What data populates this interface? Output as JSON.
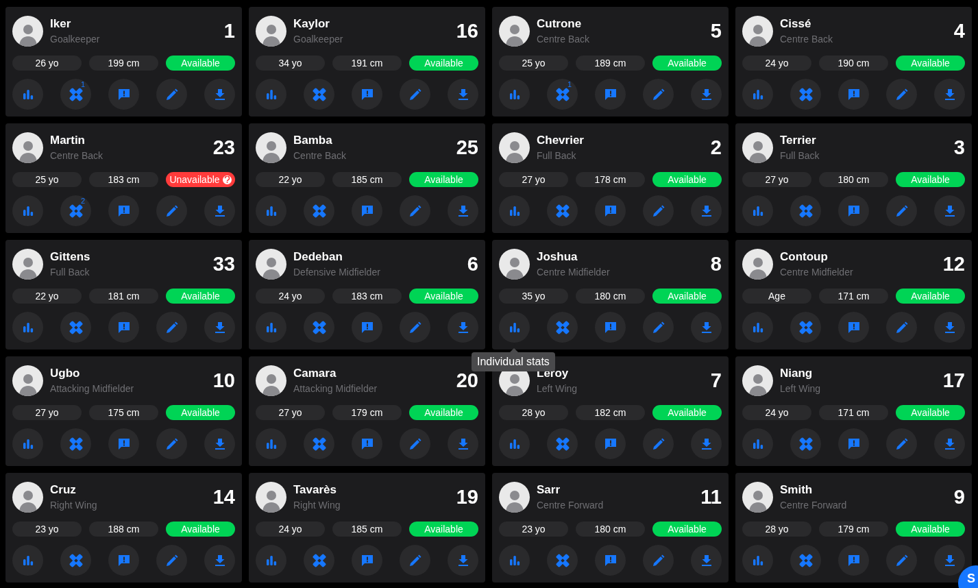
{
  "players": [
    {
      "name": "Iker",
      "position": "Goalkeeper",
      "number": "1",
      "age": "26 yo",
      "height": "199 cm",
      "status": {
        "kind": "available",
        "label": "Available"
      },
      "injuries": "1"
    },
    {
      "name": "Kaylor",
      "position": "Goalkeeper",
      "number": "16",
      "age": "34 yo",
      "height": "191 cm",
      "status": {
        "kind": "available",
        "label": "Available"
      }
    },
    {
      "name": "Cutrone",
      "position": "Centre Back",
      "number": "5",
      "age": "25 yo",
      "height": "189 cm",
      "status": {
        "kind": "available",
        "label": "Available"
      },
      "injuries": "1"
    },
    {
      "name": "Cissé",
      "position": "Centre Back",
      "number": "4",
      "age": "24 yo",
      "height": "190 cm",
      "status": {
        "kind": "available",
        "label": "Available"
      }
    },
    {
      "name": "Martin",
      "position": "Centre Back",
      "number": "23",
      "age": "25 yo",
      "height": "183 cm",
      "status": {
        "kind": "unavailable",
        "label": "Unavailable"
      },
      "injuries": "2"
    },
    {
      "name": "Bamba",
      "position": "Centre Back",
      "number": "25",
      "age": "22 yo",
      "height": "185 cm",
      "status": {
        "kind": "available",
        "label": "Available"
      }
    },
    {
      "name": "Chevrier",
      "position": "Full Back",
      "number": "2",
      "age": "27 yo",
      "height": "178 cm",
      "status": {
        "kind": "available",
        "label": "Available"
      }
    },
    {
      "name": "Terrier",
      "position": "Full Back",
      "number": "3",
      "age": "27 yo",
      "height": "180 cm",
      "status": {
        "kind": "available",
        "label": "Available"
      }
    },
    {
      "name": "Gittens",
      "position": "Full Back",
      "number": "33",
      "age": "22 yo",
      "height": "181 cm",
      "status": {
        "kind": "available",
        "label": "Available"
      }
    },
    {
      "name": "Dedeban",
      "position": "Defensive Midfielder",
      "number": "6",
      "age": "24 yo",
      "height": "183 cm",
      "status": {
        "kind": "available",
        "label": "Available"
      }
    },
    {
      "name": "Joshua",
      "position": "Centre Midfielder",
      "number": "8",
      "age": "35 yo",
      "height": "180 cm",
      "status": {
        "kind": "available",
        "label": "Available"
      },
      "tooltip": "Individual stats"
    },
    {
      "name": "Contoup",
      "position": "Centre Midfielder",
      "number": "12",
      "age": "Age",
      "height": "171 cm",
      "status": {
        "kind": "available",
        "label": "Available"
      }
    },
    {
      "name": "Ugbo",
      "position": "Attacking Midfielder",
      "number": "10",
      "age": "27 yo",
      "height": "175 cm",
      "status": {
        "kind": "available",
        "label": "Available"
      }
    },
    {
      "name": "Camara",
      "position": "Attacking Midfielder",
      "number": "20",
      "age": "27 yo",
      "height": "179 cm",
      "status": {
        "kind": "available",
        "label": "Available"
      }
    },
    {
      "name": "Leroy",
      "position": "Left Wing",
      "number": "7",
      "age": "28 yo",
      "height": "182 cm",
      "status": {
        "kind": "available",
        "label": "Available"
      }
    },
    {
      "name": "Niang",
      "position": "Left Wing",
      "number": "17",
      "age": "24 yo",
      "height": "171 cm",
      "status": {
        "kind": "available",
        "label": "Available"
      }
    },
    {
      "name": "Cruz",
      "position": "Right Wing",
      "number": "14",
      "age": "23 yo",
      "height": "188 cm",
      "status": {
        "kind": "available",
        "label": "Available"
      }
    },
    {
      "name": "Tavarès",
      "position": "Right Wing",
      "number": "19",
      "age": "24 yo",
      "height": "185 cm",
      "status": {
        "kind": "available",
        "label": "Available"
      }
    },
    {
      "name": "Sarr",
      "position": "Centre Forward",
      "number": "11",
      "age": "23 yo",
      "height": "180 cm",
      "status": {
        "kind": "available",
        "label": "Available"
      }
    },
    {
      "name": "Smith",
      "position": "Centre Forward",
      "number": "9",
      "age": "28 yo",
      "height": "179 cm",
      "status": {
        "kind": "available",
        "label": "Available"
      }
    }
  ],
  "fab": {
    "label": "S"
  }
}
